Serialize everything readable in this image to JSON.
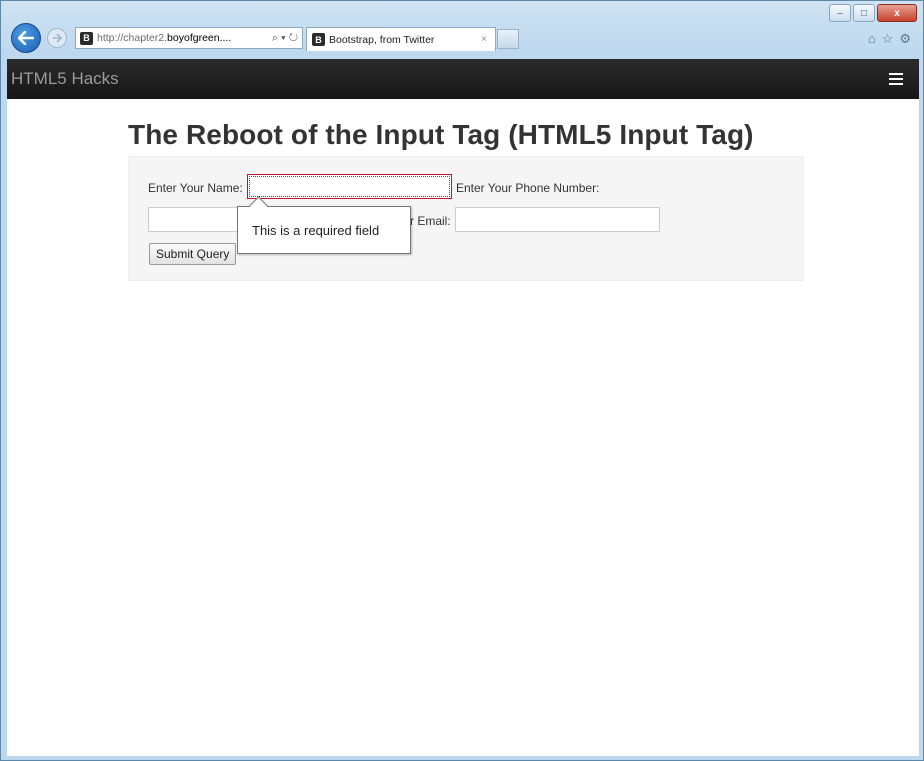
{
  "browser": {
    "address_prefix": "http://chapter2.",
    "address_host": "boyofgreen....",
    "address_controls": "⌕ ▾ ↻",
    "favicon_letter": "B",
    "tab_title": "Bootstrap, from Twitter",
    "tab_close": "×",
    "window_buttons": {
      "minimize": "–",
      "maximize": "□",
      "close": "x"
    },
    "icons": [
      "home-icon",
      "star-icon",
      "gear-icon"
    ]
  },
  "navbar": {
    "brand": "HTML5 Hacks"
  },
  "page": {
    "title": "The Reboot of the Input Tag (HTML5 Input Tag)",
    "form": {
      "name_label": "Enter Your Name:",
      "name_value": "",
      "phone_label": "Enter Your Phone Number:",
      "phone_value": "",
      "email_label_visible": "r Email:",
      "email_value": "",
      "submit_label": "Submit Query"
    },
    "validation_tooltip": "This is a required field"
  },
  "colors": {
    "navbar_bg": "#222222",
    "invalid_border": "#c8102e",
    "well_bg": "#f5f5f5"
  }
}
